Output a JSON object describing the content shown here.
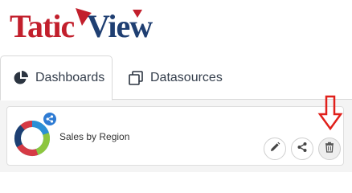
{
  "brand": {
    "name": "TaticView",
    "name_part1": "Tatic",
    "name_part2": "View",
    "colors": {
      "red": "#c21f2c",
      "navy": "#1f3f72"
    }
  },
  "tabs": [
    {
      "label": "Dashboards",
      "icon": "pie-chart-icon",
      "active": true
    },
    {
      "label": "Datasources",
      "icon": "datasources-icon",
      "active": false
    }
  ],
  "dashboard_card": {
    "title": "Sales by Region",
    "thumbnail_icon": "donut-chart-icon",
    "badge_icon": "share-icon",
    "actions": [
      {
        "name": "edit",
        "icon": "pencil-icon"
      },
      {
        "name": "share",
        "icon": "share-icon"
      },
      {
        "name": "delete",
        "icon": "trash-icon"
      }
    ]
  },
  "annotation": {
    "icon": "down-arrow-icon",
    "color": "#e0201b"
  },
  "colors": {
    "tab_text": "#333d4b",
    "panel_bg": "#f4f4f4",
    "donut": [
      "#8dc63f",
      "#2b8fd6",
      "#1d3f73",
      "#d63a45",
      "#1fa8a0"
    ]
  }
}
